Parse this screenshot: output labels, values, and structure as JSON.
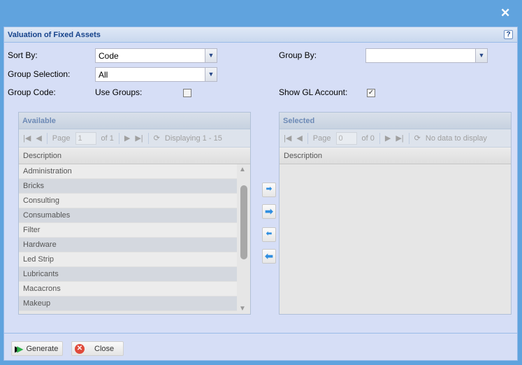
{
  "window": {
    "close_icon": "close-icon",
    "title": "Valuation of Fixed Assets",
    "help": "?"
  },
  "form": {
    "sort_by_label": "Sort By:",
    "sort_by_value": "Code",
    "group_selection_label": "Group Selection:",
    "group_selection_value": "All",
    "group_code_label": "Group Code:",
    "use_groups_label": "Use Groups:",
    "use_groups_checked": false,
    "group_by_label": "Group By:",
    "group_by_value": "",
    "show_gl_label": "Show GL Account:",
    "show_gl_checked": true,
    "show_gl_check": "✓"
  },
  "available": {
    "title": "Available",
    "page_label": "Page",
    "page": "1",
    "of": "of 1",
    "display": "Displaying 1 - 15",
    "column": "Description",
    "rows": [
      "Administration",
      "Bricks",
      "Consulting",
      "Consumables",
      "Filter",
      "Hardware",
      "Led Strip",
      "Lubricants",
      "Macacrons",
      "Makeup"
    ]
  },
  "selected": {
    "title": "Selected",
    "page_label": "Page",
    "page": "0",
    "of": "of 0",
    "display": "No data to display",
    "column": "Description"
  },
  "footer": {
    "generate": "Generate",
    "close": "Close"
  }
}
